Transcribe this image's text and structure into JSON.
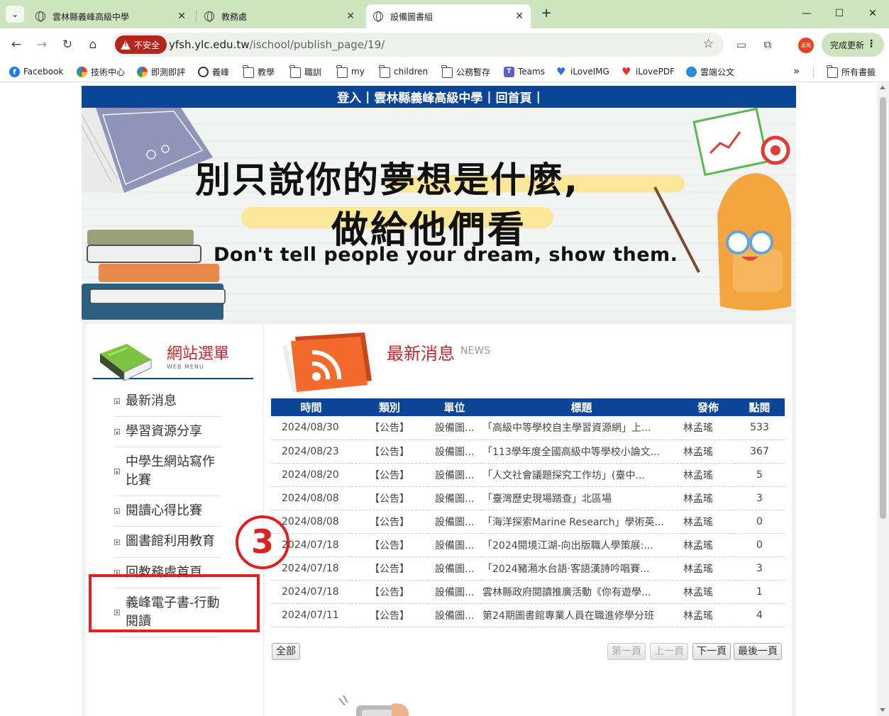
{
  "browser": {
    "tabs": [
      {
        "title": "雲林縣義峰高級中學"
      },
      {
        "title": "教務處"
      },
      {
        "title": "設備圖書組"
      }
    ],
    "url_host": "yfsh.ylc.edu.tw",
    "url_path": "/ischool/publish_page/19/",
    "insecure_label": "不安全",
    "profile_label": "孟瑤",
    "update_label": "完成更新",
    "bookmarks": [
      "Facebook",
      "技術中心",
      "即測即評",
      "義峰",
      "教學",
      "職訓",
      "my",
      "children",
      "公務暫存",
      "Teams",
      "iLoveIMG",
      "iLovePDF",
      "雲端公文"
    ],
    "all_bookmarks": "所有書籤"
  },
  "topnav": {
    "login": "登入",
    "sep": "|",
    "school": "雲林縣義峰高級中學",
    "home": "回首頁"
  },
  "banner": {
    "line1": "別只說你的夢想是什麼,",
    "line2": "做給他們看",
    "en": "Don't tell people your dream, show them."
  },
  "sidebar": {
    "title": "網站選單",
    "subtitle": "WEB MENU",
    "items": [
      {
        "label": "最新消息"
      },
      {
        "label": "學習資源分享"
      },
      {
        "label": "中學生網站寫作比賽"
      },
      {
        "label": "閱讀心得比賽"
      },
      {
        "label": "圖書館利用教育"
      },
      {
        "label": "回教務處首頁"
      },
      {
        "label": "義峰電子書-行動閱讀"
      }
    ]
  },
  "annotation": {
    "number": "3",
    "color": "#e02020"
  },
  "news": {
    "title": "最新消息",
    "title_en": "NEWS",
    "columns": [
      "時間",
      "類別",
      "單位",
      "標題",
      "發佈",
      "點閱"
    ],
    "rows": [
      {
        "date": "2024/08/30",
        "type": "【公告】",
        "unit": "設備圖...",
        "title": "「高級中等學校自主學習資源網」上...",
        "author": "林孟瑤",
        "clicks": "533"
      },
      {
        "date": "2024/08/23",
        "type": "【公告】",
        "unit": "設備圖...",
        "title": "「113學年度全國高級中等學校小論文...",
        "author": "林孟瑤",
        "clicks": "367"
      },
      {
        "date": "2024/08/20",
        "type": "【公告】",
        "unit": "設備圖...",
        "title": "「人文社會議題探究工作坊」(臺中...",
        "author": "林孟瑤",
        "clicks": "5"
      },
      {
        "date": "2024/08/08",
        "type": "【公告】",
        "unit": "設備圖...",
        "title": "「臺灣歷史現場踏查」北區場",
        "author": "林孟瑤",
        "clicks": "3"
      },
      {
        "date": "2024/08/08",
        "type": "【公告】",
        "unit": "設備圖...",
        "title": "「海洋探索Marine Research」學術英...",
        "author": "林孟瑤",
        "clicks": "0"
      },
      {
        "date": "2024/07/18",
        "type": "【公告】",
        "unit": "設備圖...",
        "title": "「2024閱境江湖-向出版職人學策展:...",
        "author": "林孟瑤",
        "clicks": "0"
      },
      {
        "date": "2024/07/18",
        "type": "【公告】",
        "unit": "設備圖...",
        "title": "「2024豬潲水台語‧客語漢詩吟唱賽...",
        "author": "林孟瑤",
        "clicks": "3"
      },
      {
        "date": "2024/07/18",
        "type": "【公告】",
        "unit": "設備圖...",
        "title": "雲林縣政府閱讀推廣活動《你有遊學...",
        "author": "林孟瑤",
        "clicks": "1"
      },
      {
        "date": "2024/07/11",
        "type": "【公告】",
        "unit": "設備圖...",
        "title": "第24期圖書館專業人員在職進修學分班",
        "author": "林孟瑤",
        "clicks": "4"
      }
    ],
    "pager": {
      "all": "全部",
      "first": "第一頁",
      "prev": "上一頁",
      "next": "下一頁",
      "last": "最後一頁"
    }
  },
  "colors": {
    "brand_blue": "#0b4596",
    "heading_red": "#c0262d",
    "tabbar_green": "#cfe5c0"
  }
}
